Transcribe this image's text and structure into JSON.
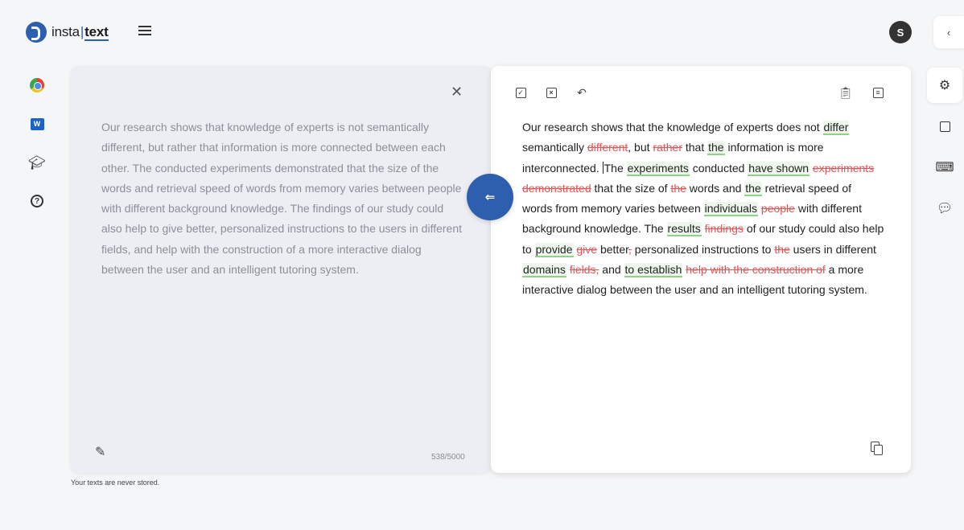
{
  "app": {
    "logo_prefix": "insta",
    "logo_sep": "|",
    "logo_suffix": "text",
    "avatar_initial": "S",
    "collapse_glyph": "‹"
  },
  "icons": {
    "menu": "hamburger-icon",
    "rail": [
      "chrome-icon",
      "word-icon",
      "graduation-cap-icon",
      "help-icon"
    ],
    "right_rail": [
      "settings-icon",
      "document-icon",
      "keyboard-icon",
      "feedback-icon"
    ]
  },
  "input": {
    "text": "Our research shows that knowledge of experts is not semantically different, but rather that information is more connected between each other. The conducted experiments demonstrated that the size of the words and retrieval speed of words from memory varies between people with different background knowledge. The findings of our study could also help to give better, personalized instructions to the users in different fields, and help with the construction of a more interactive dialog between the user and an intelligent tutoring system.",
    "counter": "538/5000",
    "note": "Your texts are never stored."
  },
  "output": {
    "segments": [
      {
        "t": "Our research shows that the knowledge of experts does not ",
        "k": "n"
      },
      {
        "t": "differ",
        "k": "i"
      },
      {
        "t": " semantically ",
        "k": "n"
      },
      {
        "t": "different",
        "k": "d"
      },
      {
        "t": ", but ",
        "k": "n"
      },
      {
        "t": "rather",
        "k": "d"
      },
      {
        "t": " that ",
        "k": "n"
      },
      {
        "t": "the",
        "k": "i"
      },
      {
        "t": " information is more interconnected. ",
        "k": "n"
      },
      {
        "t": "The ",
        "k": "c"
      },
      {
        "t": "experiments",
        "k": "i"
      },
      {
        "t": " conducted ",
        "k": "n"
      },
      {
        "t": "have shown",
        "k": "i"
      },
      {
        "t": " ",
        "k": "n"
      },
      {
        "t": "experiments demonstrated",
        "k": "d"
      },
      {
        "t": " that the size of ",
        "k": "n"
      },
      {
        "t": "the",
        "k": "d"
      },
      {
        "t": " words and ",
        "k": "n"
      },
      {
        "t": "the",
        "k": "i"
      },
      {
        "t": " retrieval speed of words from memory varies between ",
        "k": "n"
      },
      {
        "t": "individuals",
        "k": "i"
      },
      {
        "t": " ",
        "k": "n"
      },
      {
        "t": "people",
        "k": "d"
      },
      {
        "t": " with different background knowledge. The ",
        "k": "n"
      },
      {
        "t": "results",
        "k": "i"
      },
      {
        "t": " ",
        "k": "n"
      },
      {
        "t": "findings",
        "k": "d"
      },
      {
        "t": " of our study could also help to ",
        "k": "n"
      },
      {
        "t": "provide",
        "k": "i"
      },
      {
        "t": " ",
        "k": "n"
      },
      {
        "t": "give",
        "k": "d"
      },
      {
        "t": " better",
        "k": "n"
      },
      {
        "t": ",",
        "k": "d"
      },
      {
        "t": " personalized instructions to ",
        "k": "n"
      },
      {
        "t": "the",
        "k": "d"
      },
      {
        "t": " users in different ",
        "k": "n"
      },
      {
        "t": "domains",
        "k": "i"
      },
      {
        "t": " ",
        "k": "n"
      },
      {
        "t": "fields,",
        "k": "d"
      },
      {
        "t": " and ",
        "k": "n"
      },
      {
        "t": "to establish",
        "k": "i"
      },
      {
        "t": " ",
        "k": "n"
      },
      {
        "t": "help with the construction of",
        "k": "d"
      },
      {
        "t": " a more interactive dialog between the user and an intelligent tutoring system.",
        "k": "n"
      }
    ]
  },
  "colors": {
    "brand": "#2e5fae",
    "insert_underline": "#8fd08a",
    "delete_text": "#e05656"
  }
}
